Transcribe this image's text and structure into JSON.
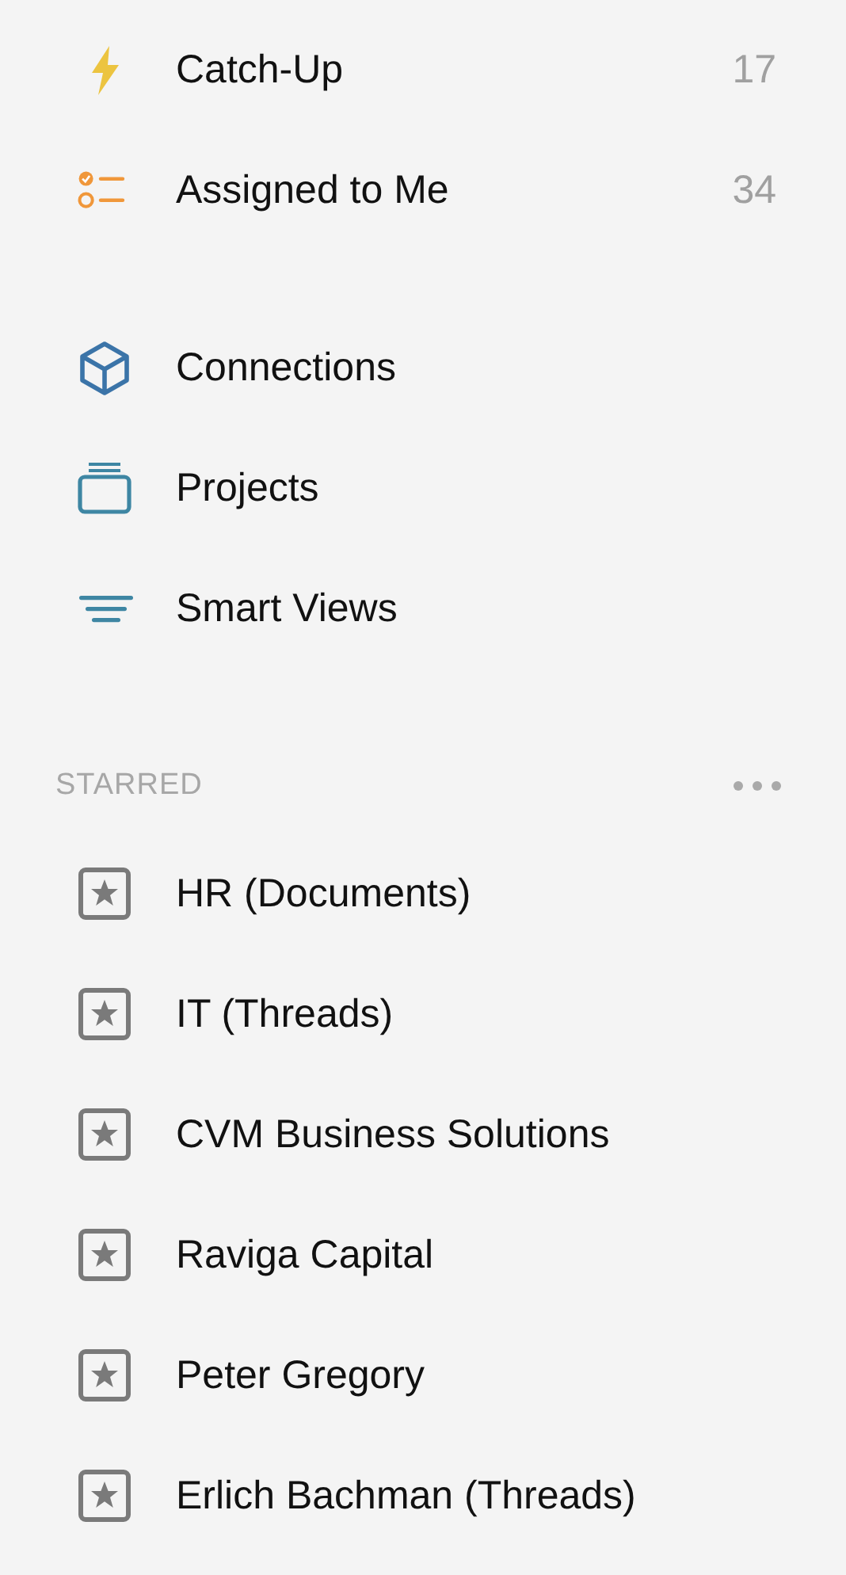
{
  "primary_items": [
    {
      "label": "Catch-Up",
      "count": "17"
    },
    {
      "label": "Assigned to Me",
      "count": "34"
    }
  ],
  "secondary_items": [
    {
      "label": "Connections"
    },
    {
      "label": "Projects"
    },
    {
      "label": "Smart Views"
    }
  ],
  "starred": {
    "title": "STARRED",
    "items": [
      {
        "label": "HR (Documents)"
      },
      {
        "label": "IT (Threads)"
      },
      {
        "label": "CVM Business Solutions"
      },
      {
        "label": "Raviga Capital"
      },
      {
        "label": "Peter Gregory"
      },
      {
        "label": "Erlich Bachman (Threads)"
      }
    ]
  }
}
